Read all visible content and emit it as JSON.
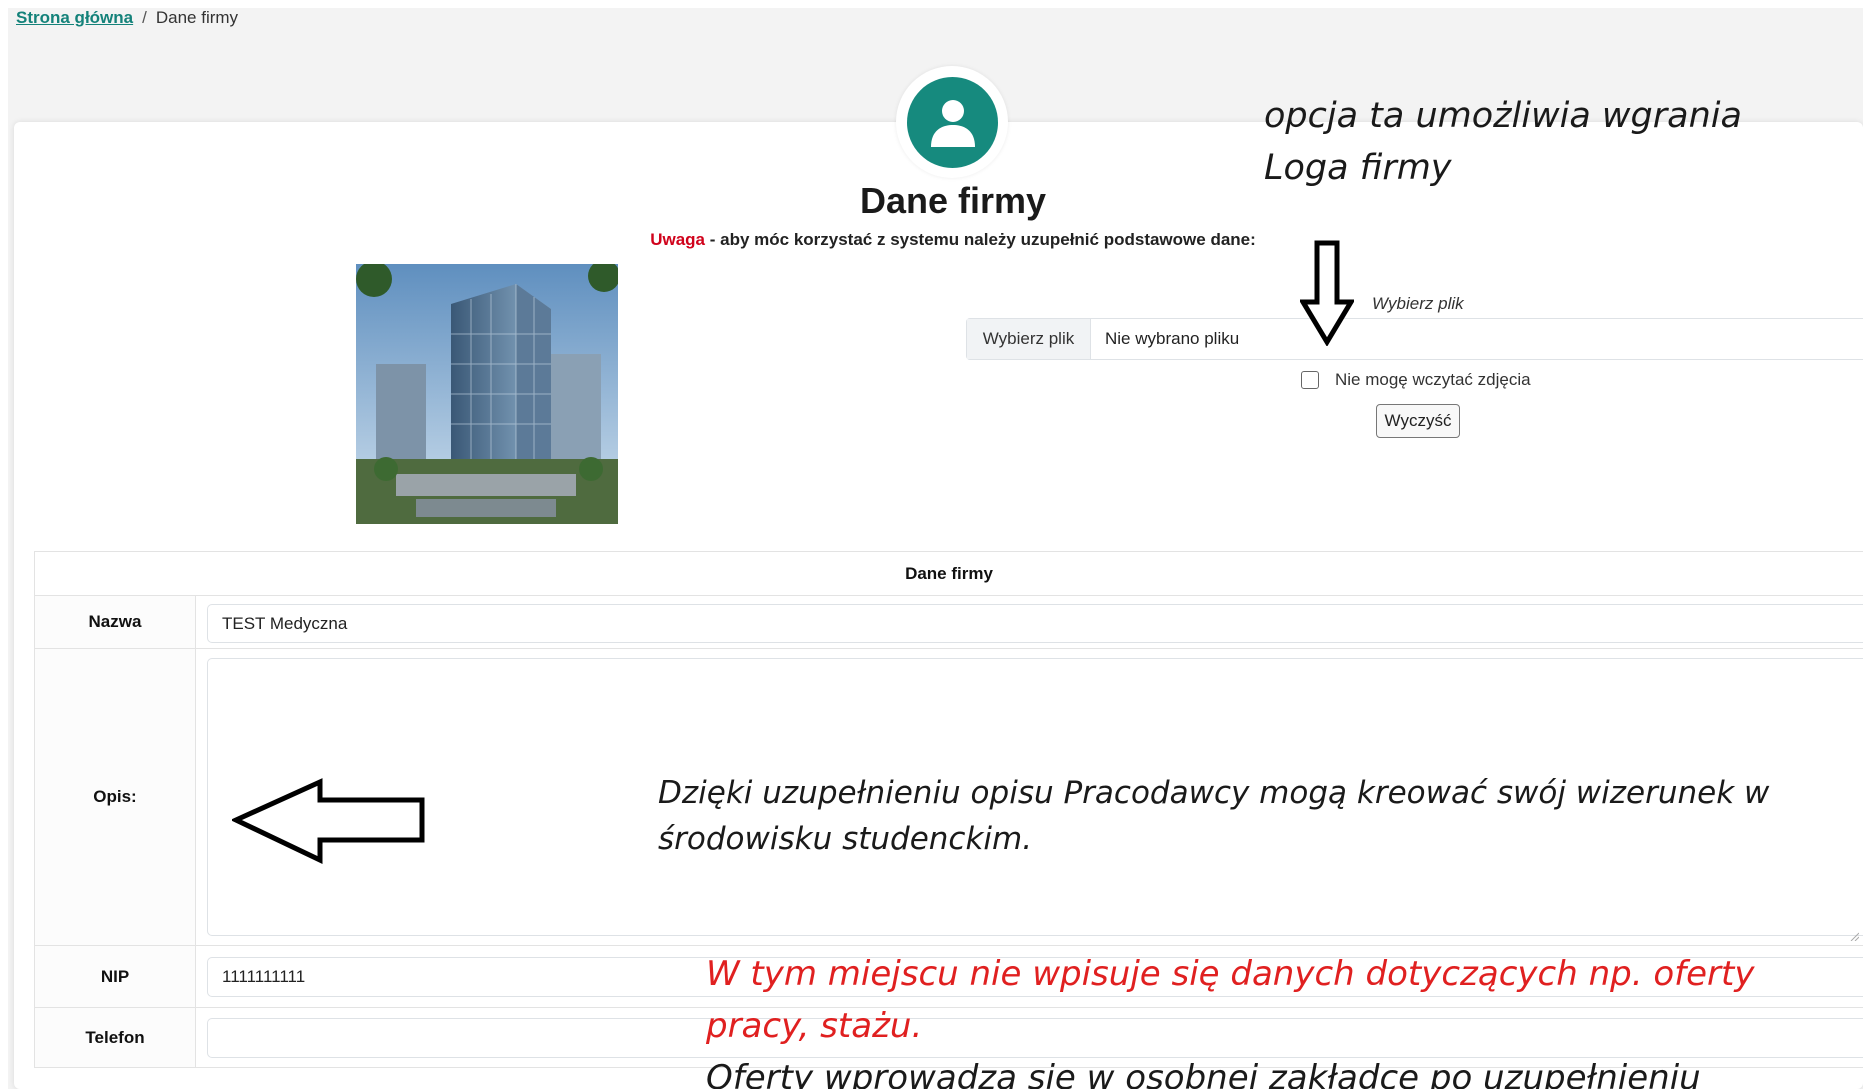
{
  "breadcrumb": {
    "home": "Strona główna",
    "separator": "/",
    "current": "Dane firmy"
  },
  "header": {
    "avatar_icon": "user-icon",
    "title": "Dane firmy",
    "warning_label": "Uwaga",
    "warning_text": " - aby móc korzystać z systemu należy uzupełnić podstawowe dane:"
  },
  "logo_upload": {
    "hint": "Wybierz plik",
    "button_label": "Wybierz plik",
    "file_name": "Nie wybrano pliku",
    "checkbox_label": "Nie mogę wczytać zdjęcia",
    "checkbox_checked": false,
    "clear_label": "Wyczyść"
  },
  "form": {
    "header": "Dane firmy",
    "rows": [
      {
        "label": "Nazwa",
        "value": "TEST Medyczna"
      },
      {
        "label": "Opis:",
        "value": ""
      },
      {
        "label": "NIP",
        "value": "1111111111"
      },
      {
        "label": "Telefon",
        "value": ""
      }
    ]
  },
  "annotations": {
    "logo_line1": "opcja ta umożliwia wgrania",
    "logo_line2": "Loga firmy",
    "opis_line1": "Dzięki uzupełnieniu opisu Pracodawcy mogą kreować swój wizerunek w",
    "opis_line2": "środowisku studenckim.",
    "warn_line1": "W tym miejscu nie wpisuje się danych dotyczących np. oferty",
    "warn_line2": "pracy, stażu.",
    "offer_line": "Oferty wprowadza się w osobnej zakładce po uzupełnieniu"
  },
  "colors": {
    "accent": "#168a7e",
    "link": "#14827a",
    "warning": "#d0021b",
    "annotation_red": "#e02020"
  }
}
